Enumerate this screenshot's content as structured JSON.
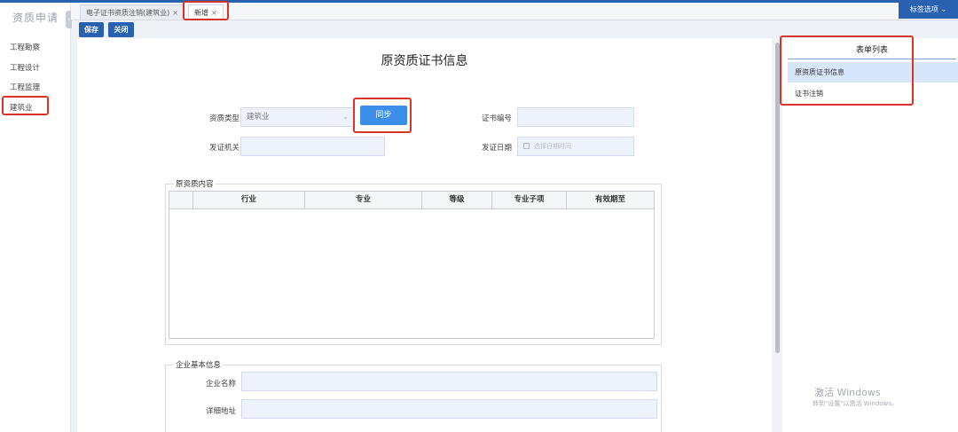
{
  "sidebar": {
    "title": "资质申请",
    "collapse_glyph": "‹",
    "items": [
      {
        "label": "工程勘察"
      },
      {
        "label": "工程设计"
      },
      {
        "label": "工程监理"
      },
      {
        "label": "建筑业"
      }
    ]
  },
  "tabs": [
    {
      "label": "电子证书资质注销(建筑业)",
      "close": "×"
    },
    {
      "label": "新增",
      "close": "×"
    }
  ],
  "header": {
    "tag_options": "标签选项",
    "tag_options_icon": "chevron-down-icon",
    "chevron": "⌄"
  },
  "toolbar": {
    "save": "保存",
    "close": "关闭"
  },
  "form": {
    "title": "原资质证书信息",
    "qualification_type_label": "资质类型",
    "qualification_type_value": "建筑业",
    "select_arrow": "⌄",
    "sync_button": "同步",
    "cert_number_label": "证书编号",
    "issuer_label": "发证机关",
    "issue_date_label": "发证日期",
    "issue_date_placeholder": "选择日期时间",
    "content_section": "原资质内容",
    "table_headers": [
      "行业",
      "专业",
      "等级",
      "专业子项",
      "有效期至"
    ],
    "company_section": "企业基本信息",
    "company_name_label": "企业名称",
    "address_label": "详细地址"
  },
  "right_panel": {
    "title": "表单列表",
    "items": [
      {
        "label": "原资质证书信息"
      },
      {
        "label": "证书注销"
      }
    ]
  },
  "watermark": {
    "line1": "激活 Windows",
    "line2": "转到\"设置\"以激活 Windows。"
  },
  "colors": {
    "primary": "#2761b0",
    "sync_button": "#3d8ee8",
    "input_bg": "#eef2fd",
    "highlight": "#d9332a"
  }
}
